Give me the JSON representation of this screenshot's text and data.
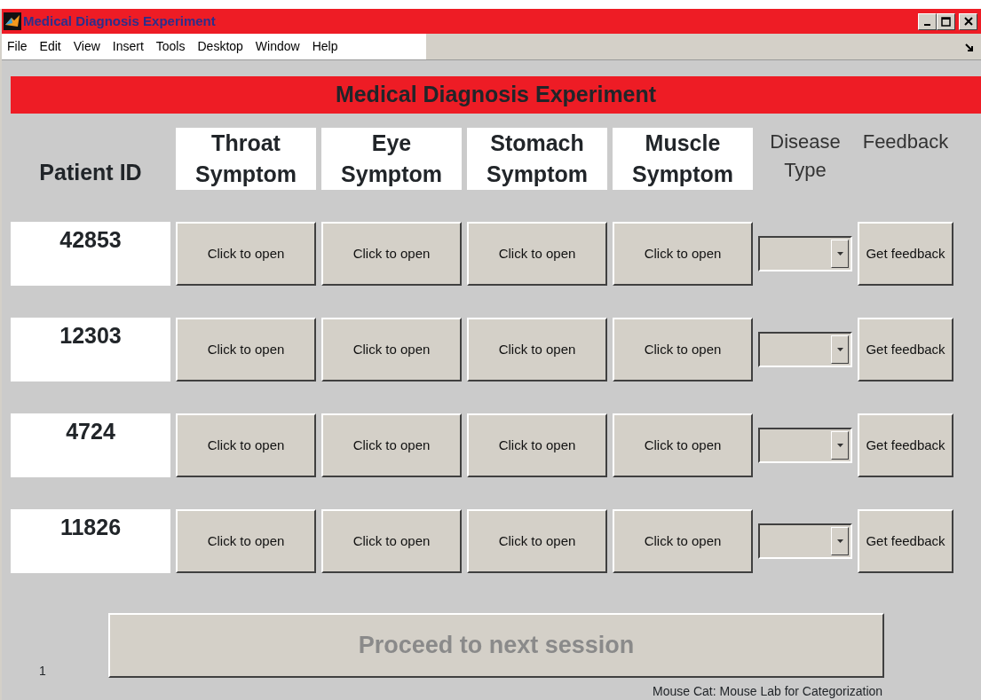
{
  "window": {
    "title": "Medical Diagnosis Experiment"
  },
  "menu": [
    "File",
    "Edit",
    "View",
    "Insert",
    "Tools",
    "Desktop",
    "Window",
    "Help"
  ],
  "banner": "Medical Diagnosis Experiment",
  "columns": [
    {
      "label": "Patient ID",
      "kind": "id"
    },
    {
      "label": "Throat Symptom",
      "kind": "symptom"
    },
    {
      "label": "Eye Symptom",
      "kind": "symptom"
    },
    {
      "label": "Stomach Symptom",
      "kind": "symptom"
    },
    {
      "label": "Muscle Symptom",
      "kind": "symptom"
    },
    {
      "label": "Disease Type",
      "kind": "plain"
    },
    {
      "label": "Feedback",
      "kind": "plain"
    }
  ],
  "rows": [
    {
      "patient_id": "42853",
      "symptoms": [
        "Click to open",
        "Click to open",
        "Click to open",
        "Click to open"
      ],
      "feedback": "Get feedback"
    },
    {
      "patient_id": "12303",
      "symptoms": [
        "Click to open",
        "Click to open",
        "Click to open",
        "Click to open"
      ],
      "feedback": "Get feedback"
    },
    {
      "patient_id": "4724",
      "symptoms": [
        "Click to open",
        "Click to open",
        "Click to open",
        "Click to open"
      ],
      "feedback": "Get feedback"
    },
    {
      "patient_id": "11826",
      "symptoms": [
        "Click to open",
        "Click to open",
        "Click to open",
        "Click to open"
      ],
      "feedback": "Get feedback"
    }
  ],
  "proceed": {
    "label": "Proceed to next session",
    "disabled": true
  },
  "page_number": "1",
  "footer": "Mouse Cat: Mouse Lab for Categorization"
}
